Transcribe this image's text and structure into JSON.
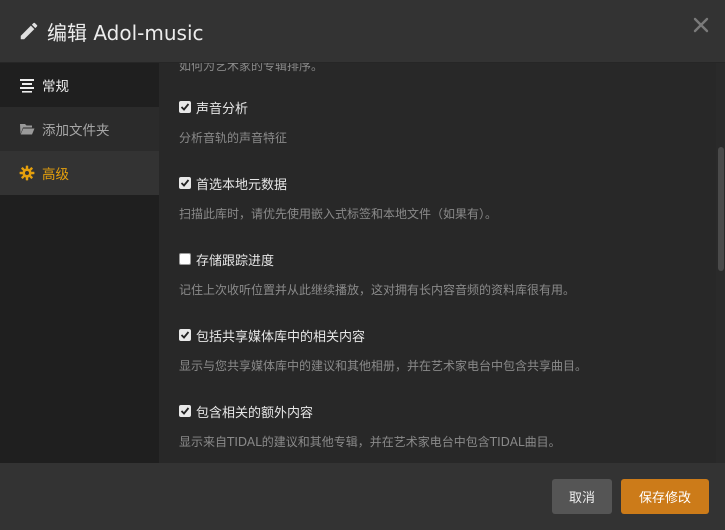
{
  "dialog": {
    "title": "编辑 Adol-music",
    "cancel_label": "取消",
    "save_label": "保存修改"
  },
  "sidebar": {
    "items": [
      {
        "label": "常规",
        "icon": "align-center-icon",
        "state": "normal"
      },
      {
        "label": "添加文件夹",
        "icon": "folder-open-icon",
        "state": "muted"
      },
      {
        "label": "高级",
        "icon": "gear-icon",
        "state": "active"
      }
    ]
  },
  "content": {
    "top_desc": "如何为艺术家的专辑排序。",
    "options": [
      {
        "label": "声音分析",
        "checked": true,
        "desc": "分析音轨的声音特征"
      },
      {
        "label": "首选本地元数据",
        "checked": true,
        "desc": "扫描此库时，请优先使用嵌入式标签和本地文件（如果有）。"
      },
      {
        "label": "存储跟踪进度",
        "checked": false,
        "desc": "记住上次收听位置并从此继续播放，这对拥有长内容音频的资料库很有用。"
      },
      {
        "label": "包括共享媒体库中的相关内容",
        "checked": true,
        "desc": "显示与您共享媒体库中的建议和其他相册，并在艺术家电台中包含共享曲目。"
      },
      {
        "label": "包含相关的额外内容",
        "checked": true,
        "desc": "显示来自TIDAL的建议和其他专辑，并在艺术家电台中包含TIDAL曲目。"
      }
    ]
  },
  "colors": {
    "accent": "#e5a00d",
    "save_button": "#cc7b19",
    "header_bg": "#333333",
    "content_bg": "#282828"
  }
}
